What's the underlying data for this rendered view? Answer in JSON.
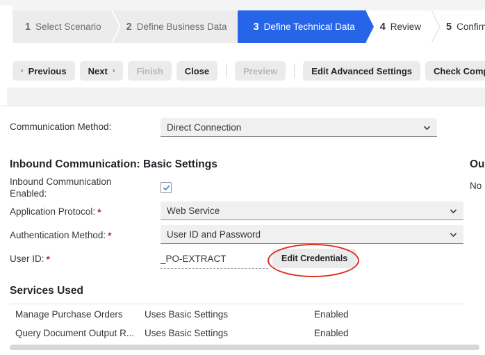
{
  "wizard": {
    "steps": [
      {
        "num": "1",
        "label": "Select Scenario",
        "state": "done"
      },
      {
        "num": "2",
        "label": "Define Business Data",
        "state": "done"
      },
      {
        "num": "3",
        "label": "Define Technical Data",
        "state": "active"
      },
      {
        "num": "4",
        "label": "Review",
        "state": "upcoming"
      },
      {
        "num": "5",
        "label": "Confirmatio",
        "state": "upcoming"
      }
    ],
    "active_color": "#2765e8",
    "inactive_bg": "#ececed"
  },
  "toolbar": {
    "previous_label": "Previous",
    "next_label": "Next",
    "finish_label": "Finish",
    "close_label": "Close",
    "preview_label": "Preview",
    "edit_advanced_label": "Edit Advanced Settings",
    "check_completeness_label": "Check Completen",
    "prev_chevron": "chevron-left-icon",
    "next_chevron": "chevron-right-icon"
  },
  "form": {
    "communication_method_label": "Communication Method:",
    "communication_method_value": "Direct Connection",
    "inbound_heading": "Inbound Communication: Basic Settings",
    "inbound_enabled_label_line1": "Inbound Communication",
    "inbound_enabled_label_line2": "Enabled:",
    "inbound_enabled_checked": true,
    "application_protocol_label": "Application Protocol:",
    "application_protocol_value": "Web Service",
    "authentication_method_label": "Authentication Method:",
    "authentication_method_value": "User ID and Password",
    "user_id_label": "User ID:",
    "user_id_value": "_PO-EXTRACT",
    "edit_credentials_label": "Edit Credentials",
    "required_marker": "*",
    "required_color": "#b2333c"
  },
  "outbound": {
    "heading": "Ou",
    "text": "No"
  },
  "services": {
    "heading": "Services Used",
    "rows": [
      {
        "name": "Manage Purchase Orders",
        "settings": "Uses Basic Settings",
        "status": "Enabled"
      },
      {
        "name": "Query Document Output R...",
        "settings": "Uses Basic Settings",
        "status": "Enabled"
      }
    ]
  },
  "annotation": {
    "target": "edit-credentials-button",
    "color": "#e02b20"
  }
}
